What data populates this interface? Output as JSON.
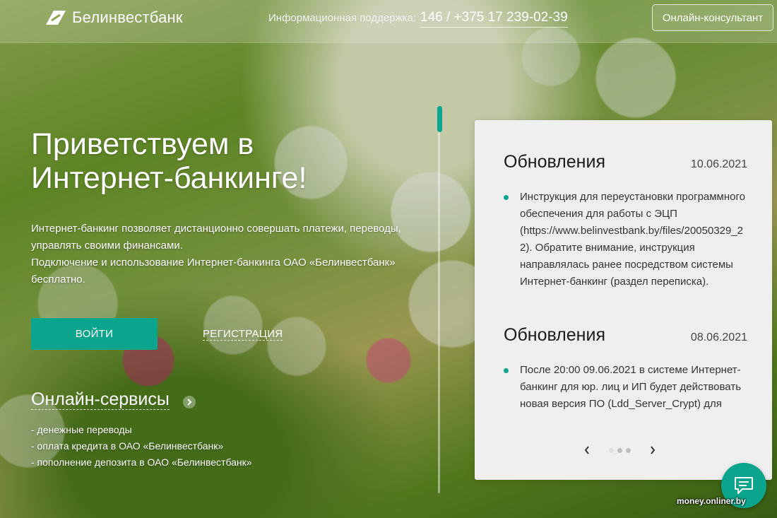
{
  "colors": {
    "accent": "#0aa58c",
    "panel_bg": "#efefef"
  },
  "header": {
    "logo_text": "Белинвестбанк",
    "support_label": "Информационная поддержка:",
    "support_phone": "146 / +375 17 239-02-39",
    "consult_button": "Онлайн-консультант"
  },
  "hero": {
    "title": "Приветствуем в Интернет-банкинге!",
    "desc_line1": "Интернет-банкинг позволяет дистанционно совершать платежи, переводы, управлять своими финансами.",
    "desc_line2": "Подключение и использование Интернет-банкинга ОАО «Белинвестбанк» бесплатно.",
    "login_button": "ВОЙТИ",
    "register_link": "РЕГИСТРАЦИЯ"
  },
  "services": {
    "title": "Онлайн-сервисы",
    "arrow_icon": "chevron-right-icon",
    "items": [
      "- денежные переводы",
      "- оплата кредита в ОАО «Белинвестбанк»",
      "- пополнение депозита в ОАО «Белинвестбанк»"
    ]
  },
  "news": {
    "items": [
      {
        "title": "Обновления",
        "date": "10.06.2021",
        "text": "Инструкция для переустановки программного обеспечения для работы с ЭЦП (https://www.belinvestbank.by/files/20050329_22). Обратите внимание, инструкция направлялась ранее посредством системы Интернет-банкинг (раздел переписка)."
      },
      {
        "title": "Обновления",
        "date": "08.06.2021",
        "text": "После 20:00 09.06.2021 в системе Интернет-банкинг для юр. лиц и ИП будет действовать новая версия ПО (Ldd_Server_Crypt) для"
      }
    ],
    "pager_prev_icon": "chevron-left-icon",
    "pager_next_icon": "chevron-right-icon",
    "pages_total": 3,
    "page_current": 1
  },
  "chat": {
    "icon": "chat-bubble-icon"
  },
  "watermark": "money.onliner.by"
}
